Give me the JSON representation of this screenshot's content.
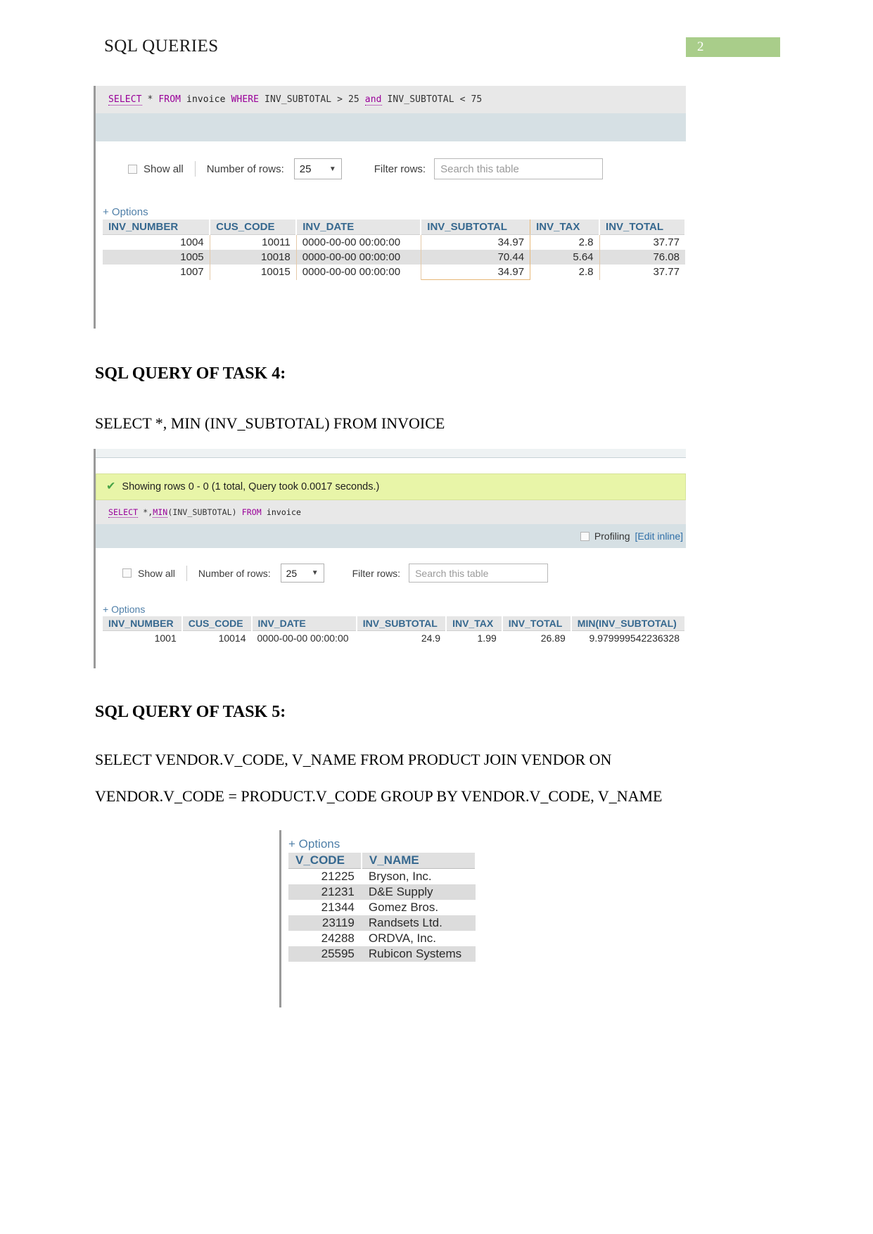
{
  "header": {
    "title": "SQL QUERIES",
    "page_number": "2"
  },
  "screenshot_1": {
    "sql": {
      "select": "SELECT",
      "star": "*",
      "from": "FROM",
      "table": "invoice",
      "where": "WHERE",
      "col1": "INV_SUBTOTAL",
      "op1": ">",
      "val1": "25",
      "and": "and",
      "col2": "INV_SUBTOTAL",
      "op2": "<",
      "val2": "75",
      "full": "SELECT * FROM invoice WHERE INV_SUBTOTAL > 25 and INV_SUBTOTAL < 75"
    },
    "toolbar": {
      "show_all": "Show all",
      "number_of_rows_label": "Number of rows:",
      "rows_value": "25",
      "filter_rows_label": "Filter rows:",
      "search_placeholder": "Search this table"
    },
    "options_label": "+ Options",
    "table": {
      "columns": [
        "INV_NUMBER",
        "CUS_CODE",
        "INV_DATE",
        "INV_SUBTOTAL",
        "INV_TAX",
        "INV_TOTAL"
      ],
      "rows": [
        [
          "1004",
          "10011",
          "0000-00-00 00:00:00",
          "34.97",
          "2.8",
          "37.77"
        ],
        [
          "1005",
          "10018",
          "0000-00-00 00:00:00",
          "70.44",
          "5.64",
          "76.08"
        ],
        [
          "1007",
          "10015",
          "0000-00-00 00:00:00",
          "34.97",
          "2.8",
          "37.77"
        ]
      ]
    }
  },
  "task4": {
    "heading": "SQL QUERY OF TASK 4:",
    "query_text": "SELECT *, MIN (INV_SUBTOTAL) FROM INVOICE"
  },
  "screenshot_2": {
    "notice": "Showing rows 0 - 0 (1 total, Query took 0.0017 seconds.)",
    "check_icon": "check-icon",
    "sql": {
      "select": "SELECT",
      "star_comma": "*,",
      "min": "MIN",
      "min_args": "(INV_SUBTOTAL)",
      "from": "FROM",
      "table": "invoice",
      "full": "SELECT *,MIN(INV_SUBTOTAL) FROM invoice"
    },
    "profiling_label": "Profiling",
    "edit_inline_label": "[Edit inline]",
    "toolbar": {
      "show_all": "Show all",
      "number_of_rows_label": "Number of rows:",
      "rows_value": "25",
      "filter_rows_label": "Filter rows:",
      "search_placeholder": "Search this table"
    },
    "options_label": "+ Options",
    "table": {
      "columns": [
        "INV_NUMBER",
        "CUS_CODE",
        "INV_DATE",
        "INV_SUBTOTAL",
        "INV_TAX",
        "INV_TOTAL",
        "MIN(INV_SUBTOTAL)"
      ],
      "rows": [
        [
          "1001",
          "10014",
          "0000-00-00 00:00:00",
          "24.9",
          "1.99",
          "26.89",
          "9.979999542236328"
        ]
      ]
    }
  },
  "task5": {
    "heading": "SQL QUERY OF TASK 5:",
    "query_line_1": "SELECT   VENDOR.V_CODE,   V_NAME   FROM   PRODUCT   JOIN   VENDOR   ON",
    "query_line_2": "VENDOR.V_CODE = PRODUCT.V_CODE GROUP BY VENDOR.V_CODE, V_NAME"
  },
  "screenshot_3": {
    "options_label": "+ Options",
    "table": {
      "columns": [
        "V_CODE",
        "V_NAME"
      ],
      "rows": [
        [
          "21225",
          "Bryson, Inc."
        ],
        [
          "21231",
          "D&E Supply"
        ],
        [
          "21344",
          "Gomez Bros."
        ],
        [
          "23119",
          "Randsets Ltd."
        ],
        [
          "24288",
          "ORDVA, Inc."
        ],
        [
          "25595",
          "Rubicon Systems"
        ]
      ]
    }
  },
  "colors": {
    "page_badge_bg": "#a9cd8a",
    "notice_bg": "#e8f5a8",
    "sql_keyword": "#990099",
    "table_header_text": "#36688f",
    "blue_bar": "#d6e0e4"
  }
}
